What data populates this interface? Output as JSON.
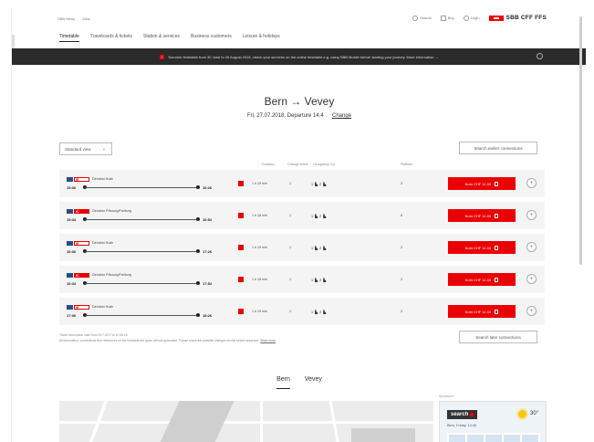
{
  "top": {
    "links": [
      "SBB News",
      "Jobs"
    ],
    "search": "Search",
    "buy": "Buy",
    "login": "Login",
    "brand": "SBB CFF FFS"
  },
  "nav": [
    "Timetable",
    "Travelcards & tickets",
    "Station & services",
    "Business customers",
    "Leisure & holidays"
  ],
  "banner": {
    "icon": "!",
    "text": "Summer timetable from 30 June to 26 August 2018, check your services on the online timetable e.g. using SBB Mobile before starting your journey. More information →"
  },
  "journey": {
    "route": "Bern → Vevey",
    "date": "Fri, 27.07.2018, Departure 14:4 .",
    "change": "Change"
  },
  "controls": {
    "sort": "Standard view",
    "earlier": "Search earlier connections",
    "later": "Search later connections"
  },
  "columns": {
    "duration": "Duration",
    "changes": "Change trains",
    "occupancy": "Occupancy 1/2",
    "platform": "Platform"
  },
  "connections": [
    {
      "badge": "IR",
      "filled": false,
      "direction": "Direction Bulle",
      "dep": "15:06",
      "arr": "16:26",
      "duration": "1 h 19 min",
      "changes": "1",
      "occupancy": "1 ▙ 2 ▙",
      "platform": "3",
      "price": "from CHF 11.00"
    },
    {
      "badge": "IC",
      "filled": true,
      "direction": "Direction Fribourg/Freiburg",
      "dep": "15:34",
      "arr": "16:52",
      "duration": "1 h 18 min",
      "changes": "1",
      "occupancy": "1 ▙ 2 ▙",
      "platform": "6",
      "price": "from CHF 11.00"
    },
    {
      "badge": "IR",
      "filled": false,
      "direction": "Direction Bulle",
      "dep": "16:06",
      "arr": "17:26",
      "duration": "1 h 19 min",
      "changes": "1",
      "occupancy": "1 ▙ 2 ▙",
      "platform": "2",
      "price": "from CHF 11.00"
    },
    {
      "badge": "IC",
      "filled": true,
      "direction": "Direction Fribourg/Freiburg",
      "dep": "16:34",
      "arr": "17:52",
      "duration": "1 h 18 min",
      "changes": "1",
      "occupancy": "1 ▙ 2 ▙",
      "platform": "2",
      "price": "from CHF 11.00"
    },
    {
      "badge": "IR",
      "filled": false,
      "direction": "Direction Bulle",
      "dep": "17:06",
      "arr": "18:26",
      "duration": "1 h 19 min",
      "changes": "1",
      "occupancy": "1 ▙ 2 ▙",
      "platform": "2",
      "price": "from CHF 11.00"
    }
  ],
  "notes": {
    "line1": "Travel information valid from 19.7.2017 to 10.06.19.",
    "line2": "All information, connections and references on the timetable are given without guarantee. Please check the possible changes shortly before departure.",
    "link": "Show more"
  },
  "stops": [
    "Bern",
    "Vevey"
  ],
  "widget": {
    "label": "Sponsored",
    "brand": "search",
    "temp": "30°",
    "city": "Bern, Friday, 14:46"
  },
  "colors": {
    "accent": "#eb0000",
    "banner_bg": "#2b2b2b",
    "train_icon": "#2f4a8a"
  }
}
